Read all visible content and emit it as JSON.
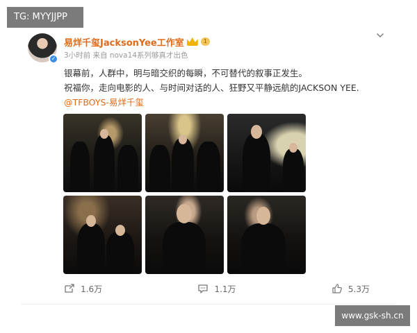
{
  "watermarks": {
    "top_left": "TG: MYYJJPP",
    "bottom_right": "www.gsk-sh.cn"
  },
  "post": {
    "author": {
      "name": "易烊千玺JacksonYee工作室",
      "level_badge": "1",
      "verified": true
    },
    "meta": "3小时前 来自 nova14系列够真才出色",
    "content": {
      "line1": "银幕前，人群中，明与暗交织的每瞬，不可替代的叙事正发生。",
      "line2": "祝福你，走向电影的人、与时间对话的人、狂野又平静远航的JACKSON YEE.",
      "mention": "@TFBOYS-易烊千玺"
    },
    "images": [
      {
        "alt": "red-carpet-crowd-photo"
      },
      {
        "alt": "red-carpet-group-photo"
      },
      {
        "alt": "red-carpet-portrait-photo"
      },
      {
        "alt": "red-carpet-walk-photo"
      },
      {
        "alt": "red-carpet-closeup-photo"
      },
      {
        "alt": "red-carpet-smile-photo"
      }
    ],
    "actions": {
      "repost": "1.6万",
      "comment": "1.1万",
      "like": "5.3万"
    }
  },
  "colors": {
    "username": "#e06c1a",
    "mention": "#e06c1a",
    "meta": "#999999",
    "watermark": "#7b7b7b"
  },
  "icons": {
    "more": "chevron-down-icon",
    "repost": "repost-icon",
    "comment": "comment-icon",
    "like": "thumbs-up-icon"
  }
}
